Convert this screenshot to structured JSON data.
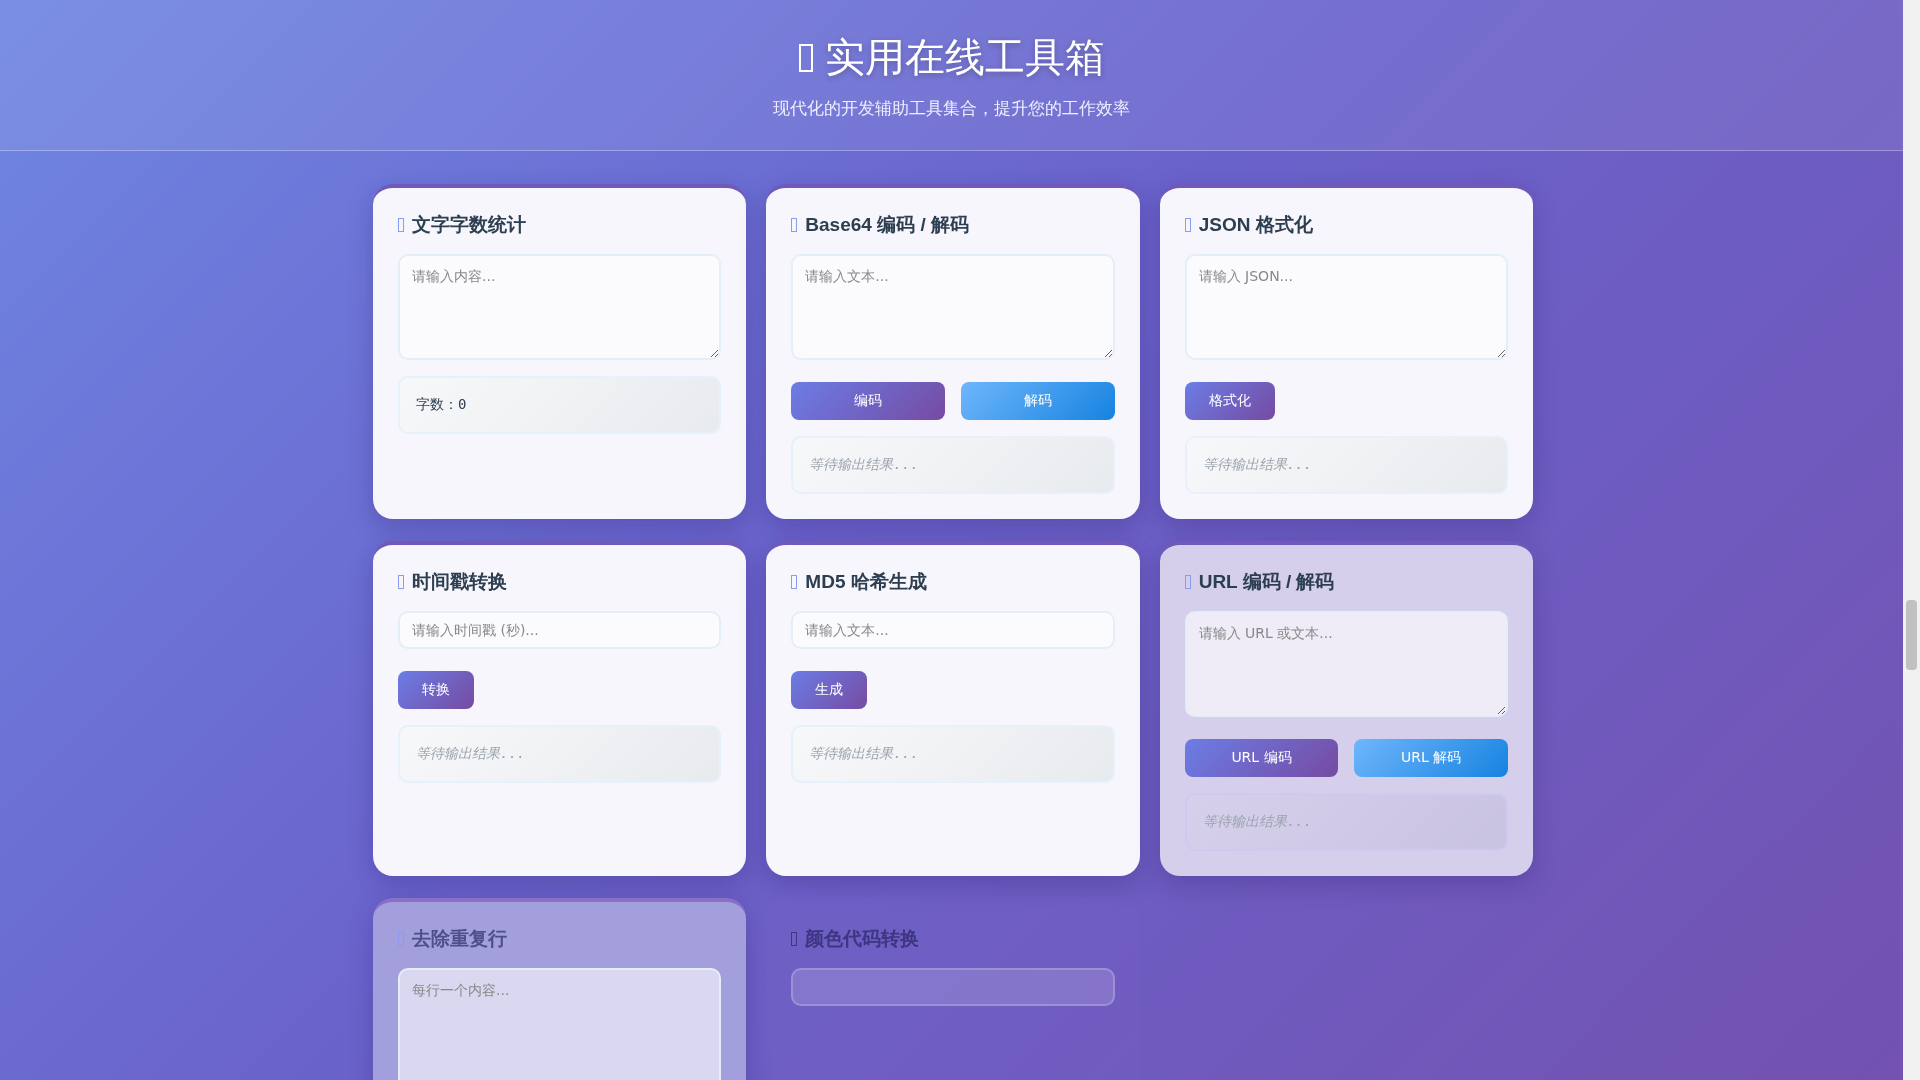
{
  "header": {
    "title": "实用在线工具箱",
    "subtitle": "现代化的开发辅助工具集合，提升您的工作效率"
  },
  "cards": [
    {
      "title": "文字字数统计",
      "input": {
        "kind": "textarea",
        "placeholder": "请输入内容..."
      },
      "output": {
        "kind": "stat",
        "text": "字数：0"
      }
    },
    {
      "title": "Base64 编码 / 解码",
      "input": {
        "kind": "textarea",
        "placeholder": "请输入文本..."
      },
      "buttons": [
        "编码",
        "解码"
      ],
      "output": {
        "kind": "result",
        "text": "等待输出结果..."
      }
    },
    {
      "title": "JSON 格式化",
      "input": {
        "kind": "textarea",
        "placeholder": "请输入 JSON..."
      },
      "buttons": [
        "格式化"
      ],
      "output": {
        "kind": "result",
        "text": "等待输出结果..."
      }
    },
    {
      "title": "时间戳转换",
      "input": {
        "kind": "line",
        "placeholder": "请输入时间戳 (秒)..."
      },
      "buttons": [
        "转换"
      ],
      "output": {
        "kind": "result",
        "text": "等待输出结果..."
      }
    },
    {
      "title": "MD5 哈希生成",
      "input": {
        "kind": "line",
        "placeholder": "请输入文本..."
      },
      "buttons": [
        "生成"
      ],
      "output": {
        "kind": "result",
        "text": "等待输出结果..."
      }
    },
    {
      "title": "URL 编码 / 解码",
      "input": {
        "kind": "textarea",
        "placeholder": "请输入 URL 或文本..."
      },
      "buttons": [
        "URL 编码",
        "URL 解码"
      ],
      "output": {
        "kind": "result",
        "text": "等待输出结果..."
      }
    },
    {
      "title": "去除重复行",
      "input": {
        "kind": "tall",
        "placeholder": "每行一个内容..."
      }
    },
    {
      "title": "颜色代码转换",
      "input": {
        "kind": "line"
      }
    }
  ]
}
